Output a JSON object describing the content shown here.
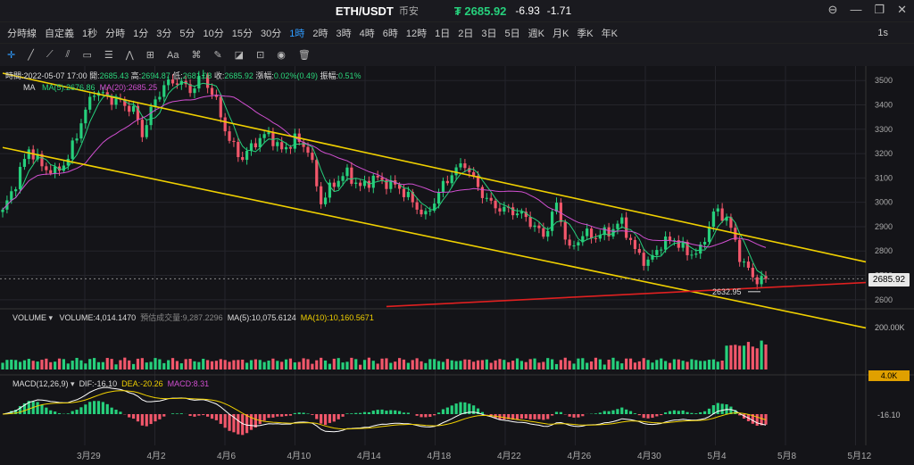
{
  "header": {
    "pair": "ETH/USDT",
    "exchange": "币安",
    "price": "₮ 2685.92",
    "change": "-6.93",
    "change_pct": "-1.71"
  },
  "timeframes": {
    "items": [
      "分時線",
      "自定義",
      "1秒",
      "分時",
      "1分",
      "3分",
      "5分",
      "10分",
      "15分",
      "30分",
      "1時",
      "2時",
      "3時",
      "4時",
      "6時",
      "12時",
      "1日",
      "2日",
      "3日",
      "5日",
      "週K",
      "月K",
      "季K",
      "年K"
    ],
    "active": "1時",
    "right": "1s"
  },
  "toolbar": {
    "aa": "Aa"
  },
  "info": {
    "time_label": "時間:",
    "time": "2022-05-07 17:00",
    "open_label": "開:",
    "open": "2685.43",
    "high_label": "高:",
    "high": "2694.87",
    "low_label": "低:",
    "low": "2681.08",
    "close_label": "收:",
    "close": "2685.92",
    "chg_label": "漲幅:",
    "chg": "0.02%(0.49)",
    "amp_label": "振幅:",
    "amp": "0.51%"
  },
  "ma": {
    "label": "MA",
    "ma5": "MA(5):2676.86",
    "ma20": "MA(20):2685.25"
  },
  "volume": {
    "label": "VOLUME",
    "value": "VOLUME:4,014.1470",
    "est": "預估成交量:9,287.2296",
    "ma5": "MA(5):10,075.6124",
    "ma10": "MA(10):10,160.5671",
    "scale": "200.00K",
    "tag": "4.0K"
  },
  "macd": {
    "label": "MACD(12,26,9)",
    "dif": "DIF:-16.10",
    "dea": "DEA:-20.26",
    "macd": "MACD:8.31",
    "scale": "-16.10"
  },
  "annotation": {
    "low_mark": "2632.95"
  },
  "current_price": "2685.92",
  "colors": {
    "up": "#26d07c",
    "down": "#f2576b",
    "ma5": "#26d07c",
    "ma20": "#d04fd0",
    "trend": "#f0d000",
    "support": "#e02020",
    "dif": "#ffffff",
    "dea": "#f0d000",
    "accent": "#2f9bff"
  },
  "chart_data": {
    "type": "candlestick",
    "title": "ETH/USDT",
    "x_labels": [
      "3月29",
      "4月2",
      "4月6",
      "4月10",
      "4月14",
      "4月18",
      "4月22",
      "4月26",
      "4月30",
      "5月4",
      "5月8",
      "5月12"
    ],
    "y_ticks": [
      3500,
      3400,
      3300,
      3200,
      3100,
      3000,
      2900,
      2800,
      2700,
      2600
    ],
    "ylim": [
      2570,
      3530
    ],
    "close_path": [
      [
        0,
        2960
      ],
      [
        3,
        3080
      ],
      [
        6,
        3220
      ],
      [
        9,
        3150
      ],
      [
        12,
        3120
      ],
      [
        15,
        3180
      ],
      [
        18,
        3330
      ],
      [
        21,
        3460
      ],
      [
        24,
        3430
      ],
      [
        27,
        3410
      ],
      [
        30,
        3380
      ],
      [
        32,
        3280
      ],
      [
        35,
        3420
      ],
      [
        37,
        3480
      ],
      [
        40,
        3500
      ],
      [
        43,
        3460
      ],
      [
        46,
        3520
      ],
      [
        49,
        3410
      ],
      [
        52,
        3250
      ],
      [
        55,
        3180
      ],
      [
        58,
        3250
      ],
      [
        61,
        3280
      ],
      [
        64,
        3210
      ],
      [
        67,
        3260
      ],
      [
        70,
        3220
      ],
      [
        73,
        3000
      ],
      [
        76,
        3080
      ],
      [
        79,
        3120
      ],
      [
        82,
        3060
      ],
      [
        85,
        3100
      ],
      [
        88,
        3080
      ],
      [
        91,
        3060
      ],
      [
        94,
        3000
      ],
      [
        97,
        2940
      ],
      [
        100,
        3040
      ],
      [
        103,
        3120
      ],
      [
        106,
        3160
      ],
      [
        109,
        3060
      ],
      [
        112,
        2990
      ],
      [
        115,
        2970
      ],
      [
        118,
        2960
      ],
      [
        121,
        2920
      ],
      [
        124,
        2860
      ],
      [
        127,
        2990
      ],
      [
        130,
        2800
      ],
      [
        133,
        2870
      ],
      [
        136,
        2860
      ],
      [
        139,
        2880
      ],
      [
        142,
        2920
      ],
      [
        145,
        2800
      ],
      [
        148,
        2750
      ],
      [
        151,
        2830
      ],
      [
        154,
        2850
      ],
      [
        157,
        2790
      ],
      [
        160,
        2800
      ],
      [
        163,
        2960
      ],
      [
        166,
        2940
      ],
      [
        169,
        2780
      ],
      [
        172,
        2690
      ],
      [
        175,
        2680
      ]
    ],
    "ma5_last": 2676.86,
    "ma20_last": 2685.25,
    "channel_upper": [
      [
        0,
        3530
      ],
      [
        175,
        2845
      ]
    ],
    "channel_lower": [
      [
        0,
        3225
      ],
      [
        175,
        2570
      ]
    ],
    "support": [
      [
        88,
        2572
      ],
      [
        175,
        2650
      ]
    ],
    "annotation_low": 2632.95,
    "current_price": 2685.92,
    "volume_ylim": [
      0,
      200000
    ],
    "macd_ylim": [
      -60,
      60
    ]
  }
}
